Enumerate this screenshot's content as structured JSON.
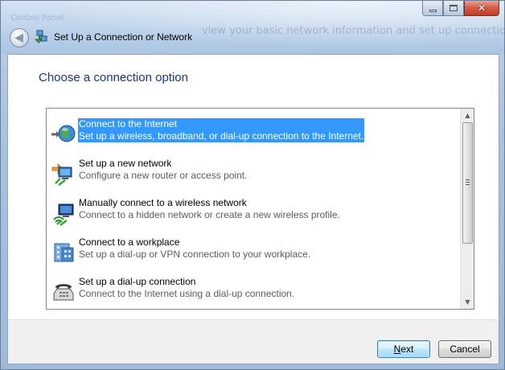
{
  "window": {
    "title": "Set Up a Connection or Network",
    "background_ghost_text": "view your basic network information and set up connections",
    "background_ghost_text_left": "Control Panel"
  },
  "content": {
    "heading": "Choose a connection option",
    "options": [
      {
        "title": "Connect to the Internet",
        "description": "Set up a wireless, broadband, or dial-up connection to the Internet.",
        "icon": "globe-network-icon",
        "selected": true
      },
      {
        "title": "Set up a new network",
        "description": "Configure a new router or access point.",
        "icon": "new-network-icon",
        "selected": false
      },
      {
        "title": "Manually connect to a wireless network",
        "description": "Connect to a hidden network or create a new wireless profile.",
        "icon": "wireless-computer-icon",
        "selected": false
      },
      {
        "title": "Connect to a workplace",
        "description": "Set up a dial-up or VPN connection to your workplace.",
        "icon": "workplace-building-icon",
        "selected": false
      },
      {
        "title": "Set up a dial-up connection",
        "description": "Connect to the Internet using a dial-up connection.",
        "icon": "telephone-modem-icon",
        "selected": false
      }
    ]
  },
  "footer": {
    "next_label_underlined": "N",
    "next_label_rest": "ext",
    "cancel_label": "Cancel"
  },
  "colors": {
    "heading": "#1e3287",
    "selection": "#3399ff",
    "description": "#5d5d5d"
  }
}
